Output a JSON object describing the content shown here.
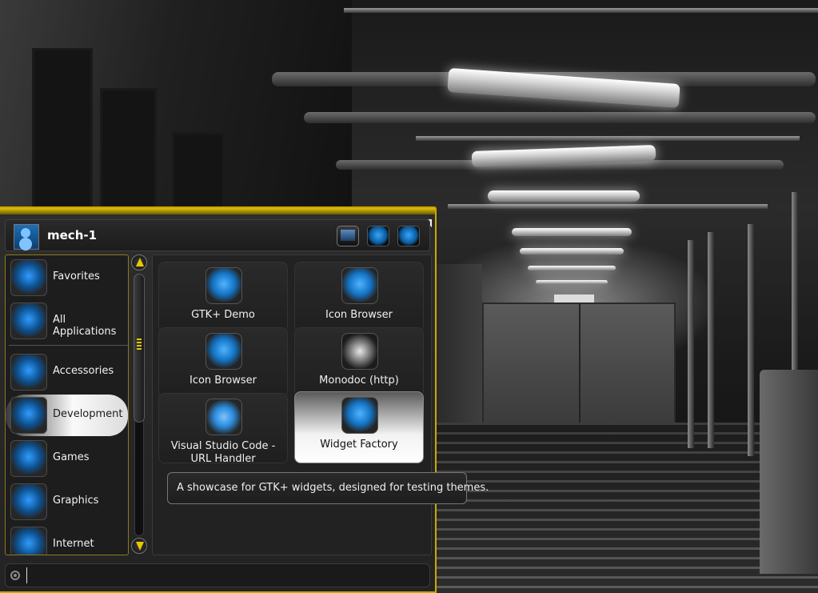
{
  "user": {
    "name": "mech-1"
  },
  "header_buttons": [
    {
      "icon": "display-settings-icon"
    },
    {
      "icon": "lock-screen-icon"
    },
    {
      "icon": "logout-icon"
    }
  ],
  "categories": [
    {
      "label": "Favorites",
      "icon": "star-icon",
      "selected": false
    },
    {
      "label": "All Applications",
      "icon": "gear-icon",
      "selected": false
    },
    {
      "label": "Accessories",
      "icon": "hexagon-grid-icon",
      "selected": false
    },
    {
      "label": "Development",
      "icon": "radar-icon",
      "selected": true
    },
    {
      "label": "Games",
      "icon": "gamepad-icon",
      "selected": false
    },
    {
      "label": "Graphics",
      "icon": "camera-lens-icon",
      "selected": false
    },
    {
      "label": "Internet",
      "icon": "globe-icon",
      "selected": false
    }
  ],
  "apps": [
    {
      "label": "GTK+ Demo",
      "icon": "cube-icon"
    },
    {
      "label": "Icon Browser",
      "icon": "cube-icon"
    },
    {
      "label": "Icon Browser",
      "icon": "cube-icon"
    },
    {
      "label": "Monodoc (http)",
      "icon": "monodoc-icon"
    },
    {
      "label": "Visual Studio Code - URL Handler",
      "icon": "vscode-icon"
    },
    {
      "label": "Widget Factory",
      "icon": "cube-icon",
      "selected": true
    }
  ],
  "tooltip": "A showcase for GTK+ widgets, designed for testing themes.",
  "search": {
    "value": "",
    "placeholder": ""
  },
  "colors": {
    "accent": "#c9a800",
    "icon_blue": "#1473c4",
    "panel": "#242424"
  }
}
